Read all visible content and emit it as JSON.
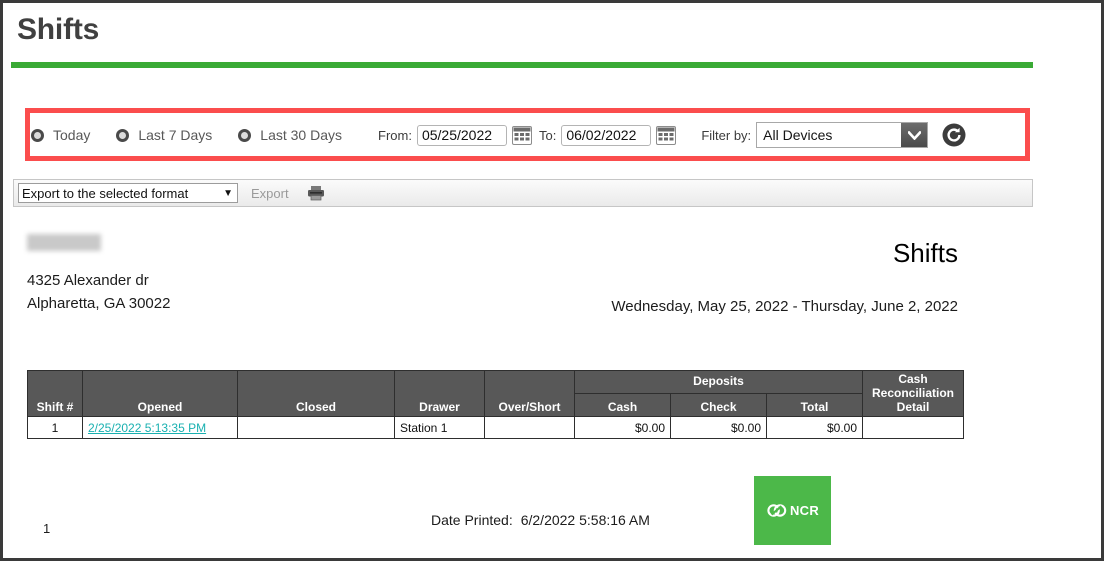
{
  "page": {
    "title": "Shifts",
    "accent_green": "#3aaa35",
    "annotation_red": "#fb4d4d"
  },
  "filter_bar": {
    "radios": [
      {
        "label": "Today",
        "selected": false,
        "icon": "radio-unchecked-icon"
      },
      {
        "label": "Last 7 Days",
        "selected": false,
        "icon": "radio-unchecked-icon"
      },
      {
        "label": "Last 30 Days",
        "selected": false,
        "icon": "radio-unchecked-icon"
      }
    ],
    "from_label": "From:",
    "from_value": "05/25/2022",
    "from_calendar_icon": "calendar-icon",
    "to_label": "To:",
    "to_value": "06/02/2022",
    "to_calendar_icon": "calendar-icon",
    "filter_by_label": "Filter by:",
    "filter_by_value": "All Devices",
    "filter_by_options": [
      "All Devices"
    ],
    "refresh_icon": "refresh-icon"
  },
  "export_toolbar": {
    "format_select_value": "Export to the selected format",
    "format_select_options": [
      "Export to the selected format"
    ],
    "export_label": "Export",
    "export_enabled": false,
    "print_icon": "printer-icon"
  },
  "report": {
    "company_name": "",
    "address_line1": "4325 Alexander dr",
    "address_line2": "Alpharetta, GA 30022",
    "title": "Shifts",
    "date_range": "Wednesday, May 25, 2022 - Thursday, June 2, 2022",
    "group_header": "Deposits",
    "columns": [
      "Shift #",
      "Opened",
      "Closed",
      "Drawer",
      "Over/Short",
      "Cash",
      "Check",
      "Total",
      "Cash Reconciliation Detail"
    ],
    "column_cash_recon_lines": [
      "Cash",
      "Reconciliation",
      "Detail"
    ],
    "rows": [
      {
        "shift_number": "1",
        "opened": "2/25/2022 5:13:35 PM",
        "opened_is_link": true,
        "closed": "",
        "drawer": "Station 1",
        "over_short": "",
        "cash": "$0.00",
        "check": "$0.00",
        "total": "$0.00",
        "cash_reconciliation_detail": ""
      }
    ]
  },
  "footer": {
    "page_number": "1",
    "date_printed_label": "Date Printed:",
    "date_printed_value": "6/2/2022 5:58:16 AM",
    "logo_text": "NCR",
    "logo_icon": "ncr-logo-icon",
    "logo_color": "#4cb849"
  }
}
